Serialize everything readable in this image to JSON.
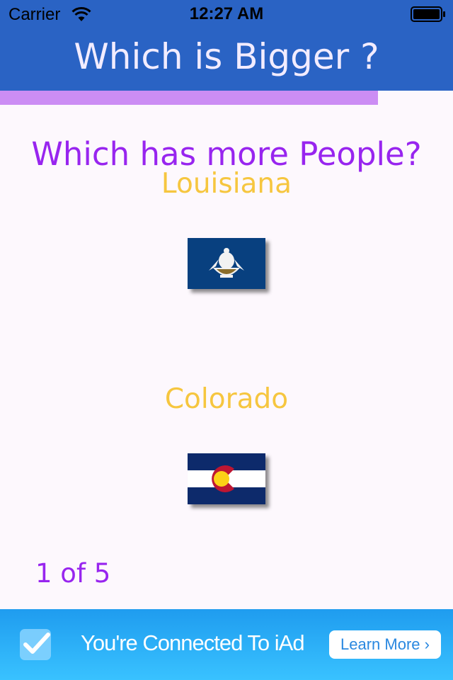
{
  "status_bar": {
    "carrier": "Carrier",
    "time": "12:27 AM"
  },
  "header": {
    "title": "Which is Bigger ?"
  },
  "progress": {
    "fraction": 0.834
  },
  "quiz": {
    "question": "Which has more People?",
    "options": [
      {
        "name": "Louisiana",
        "flag_icon": "louisiana-flag"
      },
      {
        "name": "Colorado",
        "flag_icon": "colorado-flag"
      }
    ],
    "counter": "1 of 5"
  },
  "ad": {
    "text": "You're Connected To iAd",
    "button_label": "Learn More ›"
  },
  "colors": {
    "header_bg": "#2a63c4",
    "accent_purple": "#9825ef",
    "state_name_gold": "#f6c63f",
    "progress_fill": "#cc8df4",
    "ad_blue": "#1f9cef"
  }
}
